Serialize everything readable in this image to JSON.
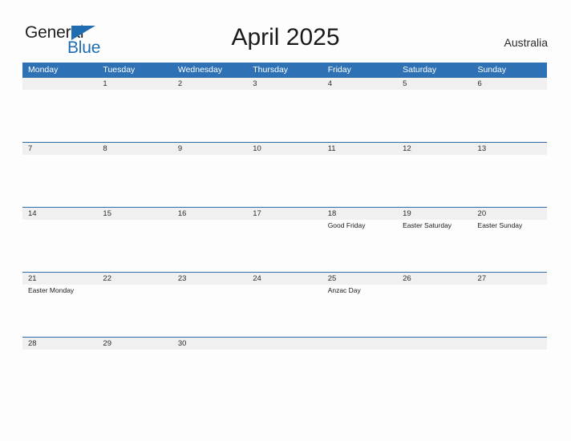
{
  "brand": {
    "name_part1": "General",
    "name_part2": "Blue",
    "triangle_color": "#1f6cb0"
  },
  "header": {
    "title": "April 2025",
    "region": "Australia"
  },
  "theme": {
    "header_blue": "#2e72b5",
    "line_blue": "#2e6ca8",
    "band_gray": "#f0f0f0",
    "page_background": "#fdfdfd"
  },
  "calendar": {
    "weekdays": [
      "Monday",
      "Tuesday",
      "Wednesday",
      "Thursday",
      "Friday",
      "Saturday",
      "Sunday"
    ],
    "weeks": [
      {
        "days": [
          {
            "date": "",
            "event": ""
          },
          {
            "date": "1",
            "event": ""
          },
          {
            "date": "2",
            "event": ""
          },
          {
            "date": "3",
            "event": ""
          },
          {
            "date": "4",
            "event": ""
          },
          {
            "date": "5",
            "event": ""
          },
          {
            "date": "6",
            "event": ""
          }
        ]
      },
      {
        "days": [
          {
            "date": "7",
            "event": ""
          },
          {
            "date": "8",
            "event": ""
          },
          {
            "date": "9",
            "event": ""
          },
          {
            "date": "10",
            "event": ""
          },
          {
            "date": "11",
            "event": ""
          },
          {
            "date": "12",
            "event": ""
          },
          {
            "date": "13",
            "event": ""
          }
        ]
      },
      {
        "days": [
          {
            "date": "14",
            "event": ""
          },
          {
            "date": "15",
            "event": ""
          },
          {
            "date": "16",
            "event": ""
          },
          {
            "date": "17",
            "event": ""
          },
          {
            "date": "18",
            "event": "Good Friday"
          },
          {
            "date": "19",
            "event": "Easter Saturday"
          },
          {
            "date": "20",
            "event": "Easter Sunday"
          }
        ]
      },
      {
        "days": [
          {
            "date": "21",
            "event": "Easter Monday"
          },
          {
            "date": "22",
            "event": ""
          },
          {
            "date": "23",
            "event": ""
          },
          {
            "date": "24",
            "event": ""
          },
          {
            "date": "25",
            "event": "Anzac Day"
          },
          {
            "date": "26",
            "event": ""
          },
          {
            "date": "27",
            "event": ""
          }
        ]
      },
      {
        "days": [
          {
            "date": "28",
            "event": ""
          },
          {
            "date": "29",
            "event": ""
          },
          {
            "date": "30",
            "event": ""
          },
          {
            "date": "",
            "event": ""
          },
          {
            "date": "",
            "event": ""
          },
          {
            "date": "",
            "event": ""
          },
          {
            "date": "",
            "event": ""
          }
        ]
      }
    ]
  }
}
